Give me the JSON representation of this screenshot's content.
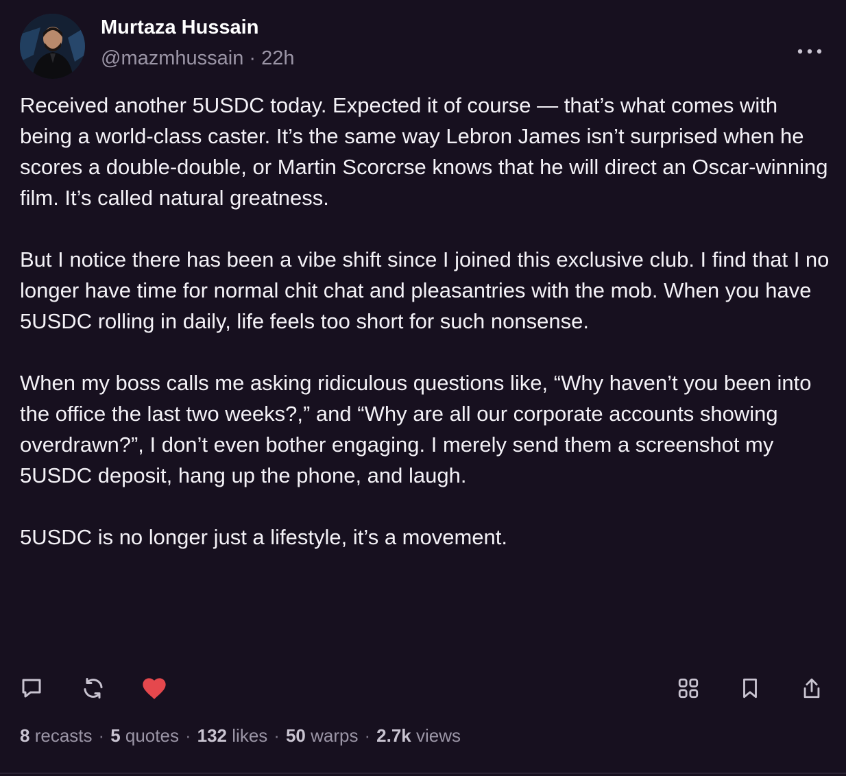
{
  "author": {
    "display_name": "Murtaza Hussain",
    "handle": "@mazmhussain",
    "separator": "·",
    "timestamp": "22h"
  },
  "post": {
    "paragraphs": [
      "Received another 5USDC today. Expected it of course — that’s what comes with being a world-class caster. It’s the same way Lebron James isn’t surprised when he scores a double-double, or Martin Scorcrse knows that he will direct an Oscar-winning film. It’s called natural greatness.",
      "But I notice there has been a vibe shift since I joined this exclusive club. I find that I no longer have time for normal chit chat and pleasantries with the mob. When you have 5USDC rolling in daily, life feels too short for such nonsense.",
      "When my boss calls me asking ridiculous questions like, “Why haven’t you been into the office the last two weeks?,” and “Why are all our corporate accounts showing overdrawn?”, I don’t even bother engaging. I merely send them a screenshot my 5USDC deposit, hang up the phone, and laugh.",
      "5USDC is no longer just a lifestyle, it’s a movement."
    ]
  },
  "actions": {
    "left": [
      {
        "icon": "reply-icon"
      },
      {
        "icon": "recast-icon"
      },
      {
        "icon": "heart-icon",
        "active": true
      }
    ],
    "right": [
      {
        "icon": "apps-grid-icon"
      },
      {
        "icon": "bookmark-icon"
      },
      {
        "icon": "share-icon"
      }
    ]
  },
  "stats": {
    "recasts": {
      "count": "8",
      "label": "recasts"
    },
    "quotes": {
      "count": "5",
      "label": "quotes"
    },
    "likes": {
      "count": "132",
      "label": "likes"
    },
    "warps": {
      "count": "50",
      "label": "warps"
    },
    "views": {
      "count": "2.7k",
      "label": "views"
    },
    "separator": "·"
  },
  "colors": {
    "background": "#17101f",
    "text": "#f4f2f7",
    "muted": "#9b95a6",
    "heart": "#e5484d",
    "icon": "#c9c4d1"
  }
}
